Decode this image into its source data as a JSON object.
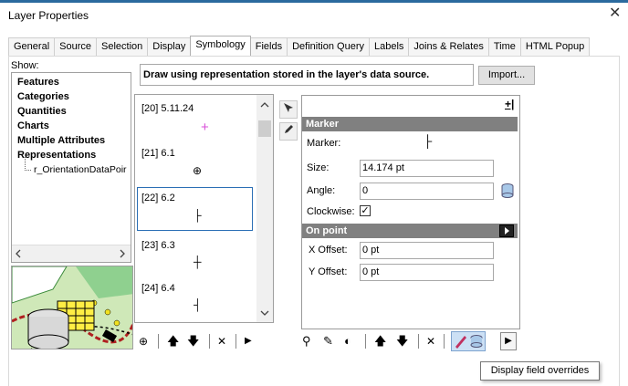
{
  "window": {
    "title": "Layer Properties",
    "close_glyph": "✕"
  },
  "tabs": [
    {
      "label": "General"
    },
    {
      "label": "Source"
    },
    {
      "label": "Selection"
    },
    {
      "label": "Display"
    },
    {
      "label": "Symbology",
      "active": true
    },
    {
      "label": "Fields"
    },
    {
      "label": "Definition Query"
    },
    {
      "label": "Labels"
    },
    {
      "label": "Joins & Relates"
    },
    {
      "label": "Time"
    },
    {
      "label": "HTML Popup"
    }
  ],
  "show": {
    "label": "Show:",
    "items": [
      "Features",
      "Categories",
      "Quantities",
      "Charts",
      "Multiple Attributes",
      "Representations"
    ],
    "sub_item": "r_OrientationDataPoir"
  },
  "description": "Draw using representation stored in the layer's data source.",
  "import_button": "Import...",
  "representations": [
    {
      "label": "[20] 5.11.24",
      "symbol": "+",
      "color": "#d84fd8"
    },
    {
      "label": "[21] 6.1",
      "symbol": "⊕",
      "color": "#000000"
    },
    {
      "label": "[22] 6.2",
      "symbol": "├",
      "color": "#000000",
      "selected": true
    },
    {
      "label": "[23] 6.3",
      "symbol": "┼",
      "color": "#000000"
    },
    {
      "label": "[24] 6.4",
      "symbol": "┤",
      "color": "#000000"
    }
  ],
  "marker_panel": {
    "plus_glyph": "+|",
    "marker_header": "Marker",
    "marker_label": "Marker:",
    "marker_symbol": "├",
    "size_label": "Size:",
    "size_value": "14.174 pt",
    "angle_label": "Angle:",
    "angle_value": "0",
    "clockwise_label": "Clockwise:",
    "clockwise_checked": "✓",
    "onpoint_header": "On point",
    "xoffset_label": "X Offset:",
    "xoffset_value": "0 pt",
    "yoffset_label": "Y Offset:",
    "yoffset_value": "0 pt"
  },
  "list_toolbar": {
    "add": "⊕",
    "up": "🡅",
    "down": "🡇",
    "remove": "✕",
    "more": "▶"
  },
  "props_toolbar": {
    "a": "⚲",
    "b": "✎",
    "c": "◐",
    "up": "🡅",
    "down": "🡇",
    "remove": "✕",
    "more": "▶"
  },
  "tooltip": "Display field overrides",
  "colors": {
    "accent": "#2b6fb5",
    "group_header": "#808080"
  }
}
